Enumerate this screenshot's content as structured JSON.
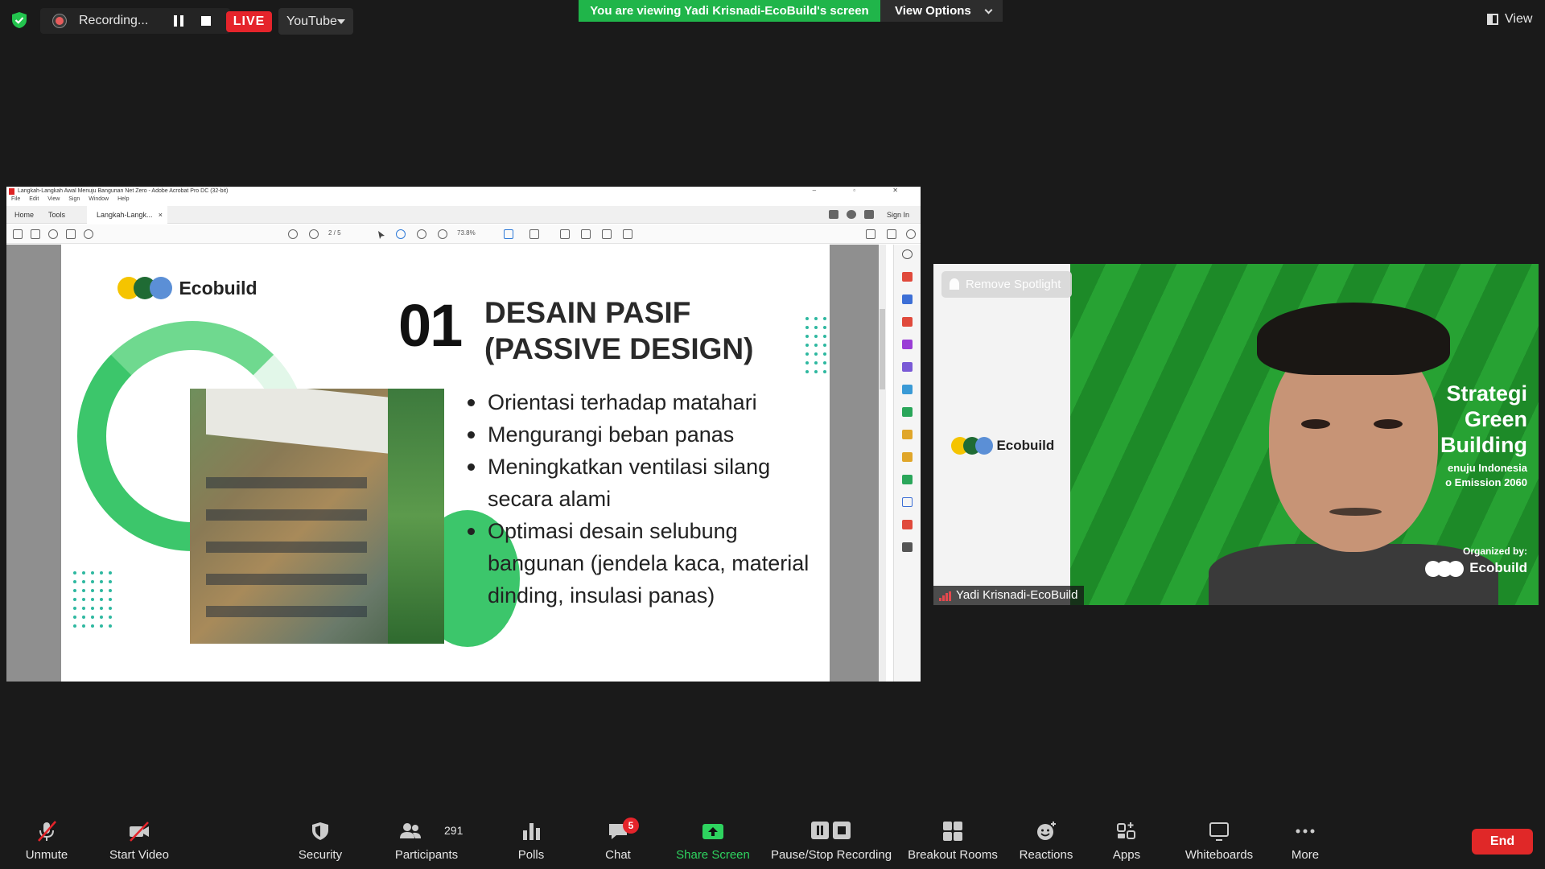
{
  "top_bar": {
    "recording_label": "Recording...",
    "live_label": "LIVE",
    "stream_target": "YouTube",
    "viewing_banner": "You are viewing Yadi Krisnadi-EcoBuild's screen",
    "view_options_label": "View Options",
    "view_label": "View"
  },
  "acrobat": {
    "window_title": "Langkah-Langkah Awal Menuju Bangunan Net Zero - Adobe Acrobat Pro DC (32-bit)",
    "menu": [
      "File",
      "Edit",
      "View",
      "Sign",
      "Window",
      "Help"
    ],
    "tabs": {
      "home": "Home",
      "tools": "Tools",
      "document": "Langkah-Langk..."
    },
    "sign_in": "Sign In",
    "page_indicator": "2 / 5",
    "zoom": "73.8%"
  },
  "slide": {
    "brand": "Ecobuild",
    "number": "01",
    "heading_line1": "DESAIN PASIF",
    "heading_line2": "(PASSIVE DESIGN)",
    "bullets": [
      "Orientasi terhadap matahari",
      "Mengurangi beban panas",
      "Meningkatkan ventilasi silang secara alami",
      "Optimasi desain selubung bangunan (jendela kaca, material dinding, insulasi panas)"
    ],
    "logo_colors": [
      "#f5c400",
      "#1f6b34",
      "#5b8fd6"
    ],
    "accent_color": "#3cc66b"
  },
  "video": {
    "remove_spotlight": "Remove Spotlight",
    "participant_name": "Yadi Krisnadi-EcoBuild",
    "brand": "Ecobuild",
    "side_title": [
      "Strategi",
      "Green",
      "Building"
    ],
    "side_sub": [
      "enuju Indonesia",
      "o Emission 2060"
    ],
    "organized_by": "Organized by:",
    "organizer": "Ecobuild"
  },
  "toolbar": {
    "unmute": "Unmute",
    "start_video": "Start Video",
    "security": "Security",
    "participants": "Participants",
    "participant_count": "291",
    "polls": "Polls",
    "chat": "Chat",
    "chat_badge": "5",
    "share_screen": "Share Screen",
    "pause_stop_recording": "Pause/Stop Recording",
    "breakout_rooms": "Breakout Rooms",
    "reactions": "Reactions",
    "apps": "Apps",
    "whiteboards": "Whiteboards",
    "more": "More",
    "end": "End"
  }
}
